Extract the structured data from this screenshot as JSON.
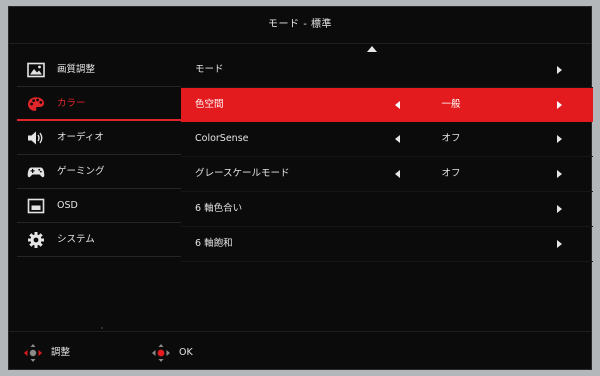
{
  "title": "モード - 標準",
  "sidebar": {
    "items": [
      {
        "label": "画質調整",
        "icon": "picture-icon",
        "active": false
      },
      {
        "label": "カラー",
        "icon": "palette-icon",
        "active": true
      },
      {
        "label": "オーディオ",
        "icon": "speaker-icon",
        "active": false
      },
      {
        "label": "ゲーミング",
        "icon": "gamepad-icon",
        "active": false
      },
      {
        "label": "OSD",
        "icon": "osd-window-icon",
        "active": false
      },
      {
        "label": "システム",
        "icon": "gear-icon",
        "active": false
      }
    ]
  },
  "main": {
    "rows": [
      {
        "label": "モード",
        "value": ""
      },
      {
        "label": "色空間",
        "value": "一般"
      },
      {
        "label": "ColorSense",
        "value": "オフ"
      },
      {
        "label": "グレースケールモード",
        "value": "オフ"
      },
      {
        "label": "6 軸色合い",
        "value": ""
      },
      {
        "label": "6 軸飽和",
        "value": ""
      }
    ]
  },
  "footer": {
    "adjust_label": "調整",
    "ok_label": "OK"
  },
  "colors": {
    "accent": "#e31b1f",
    "background": "#0b0b0b",
    "text": "#e4e4e4"
  }
}
